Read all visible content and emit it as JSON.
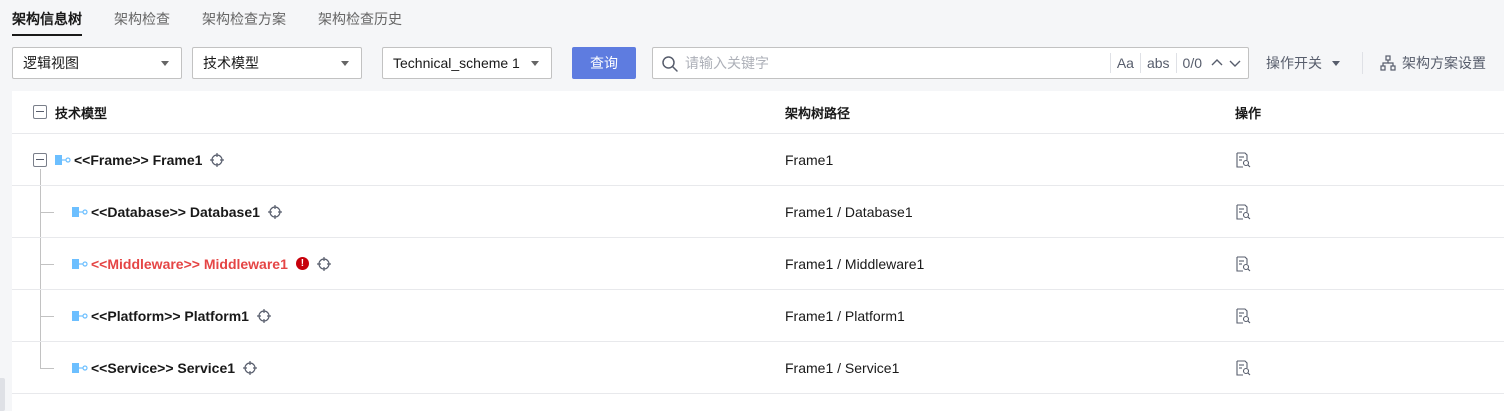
{
  "tabs": [
    {
      "label": "架构信息树",
      "active": true
    },
    {
      "label": "架构检查",
      "active": false
    },
    {
      "label": "架构检查方案",
      "active": false
    },
    {
      "label": "架构检查历史",
      "active": false
    }
  ],
  "toolbar": {
    "view_select": "逻辑视图",
    "model_select": "技术模型",
    "scheme_select": "Technical_scheme 1",
    "query_label": "查询",
    "search": {
      "placeholder": "请输入关键字",
      "value": "",
      "case_label": "Aa",
      "abs_label": "abs",
      "counter": "0/0"
    },
    "ops_switch_label": "操作开关",
    "settings_label": "架构方案设置"
  },
  "table": {
    "headers": {
      "model": "技术模型",
      "path": "架构树路径",
      "op": "操作"
    },
    "rows": [
      {
        "label": "<<Frame>> Frame1",
        "path": "Frame1",
        "level": 0,
        "error": false
      },
      {
        "label": "<<Database>> Database1",
        "path": "Frame1 / Database1",
        "level": 1,
        "error": false
      },
      {
        "label": "<<Middleware>> Middleware1",
        "path": "Frame1 / Middleware1",
        "level": 1,
        "error": true,
        "error_mark": "!"
      },
      {
        "label": "<<Platform>> Platform1",
        "path": "Frame1 / Platform1",
        "level": 1,
        "error": false
      },
      {
        "label": "<<Service>> Service1",
        "path": "Frame1 / Service1",
        "level": 1,
        "error": false
      }
    ]
  },
  "colors": {
    "primary": "#5e7ce0",
    "error_text": "#e54545",
    "error_icon": "#c7000b",
    "node_icon": "#6cbfff"
  },
  "icons": {
    "search": "search-icon",
    "node": "node-icon",
    "locate": "crosshair-icon",
    "op": "inspect-document-icon",
    "settings": "hierarchy-icon"
  }
}
